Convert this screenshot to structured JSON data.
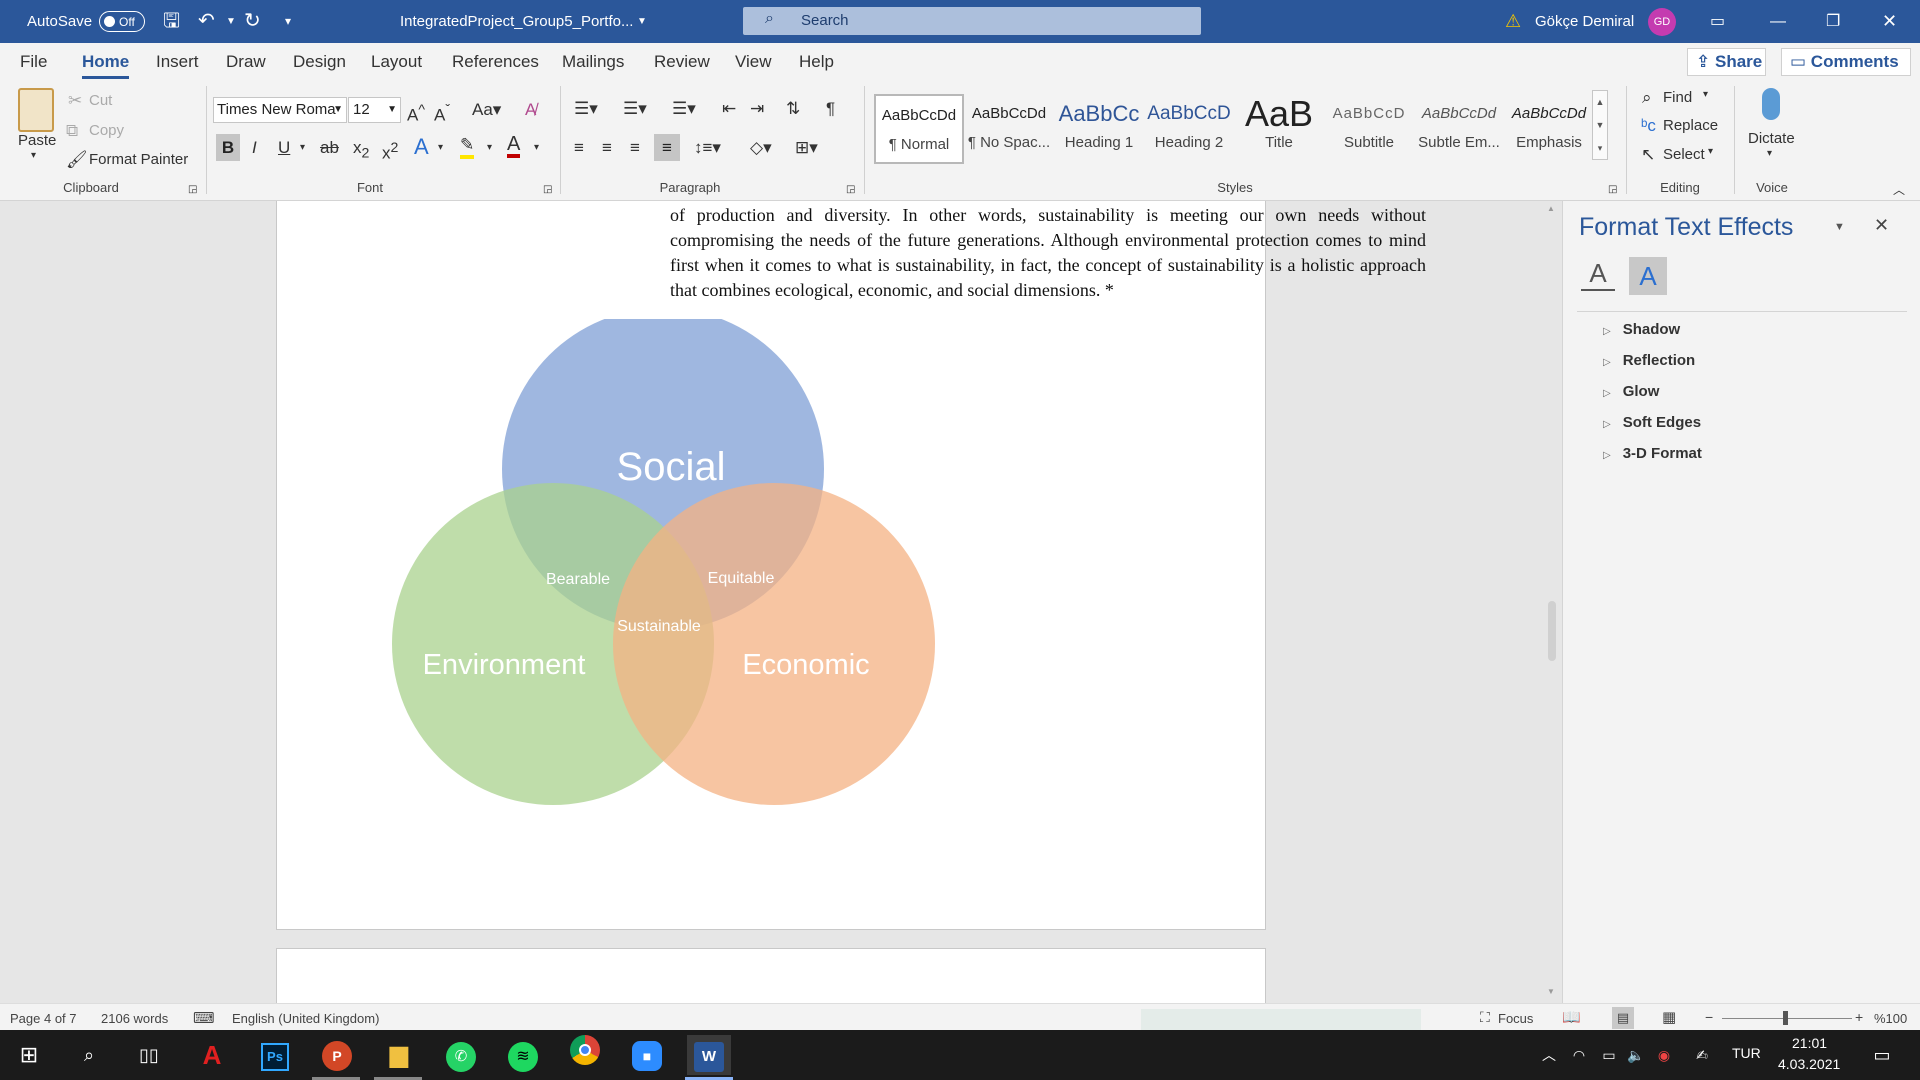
{
  "titlebar": {
    "autosave_label": "AutoSave",
    "autosave_state": "Off",
    "doc_title": "IntegratedProject_Group5_Portfo...",
    "search_placeholder": "Search",
    "user_name": "Gökçe Demiral",
    "user_initials": "GD"
  },
  "tabs": [
    "File",
    "Home",
    "Insert",
    "Draw",
    "Design",
    "Layout",
    "References",
    "Mailings",
    "Review",
    "View",
    "Help"
  ],
  "share_label": "Share",
  "comments_label": "Comments",
  "clipboard": {
    "paste": "Paste",
    "cut": "Cut",
    "copy": "Copy",
    "format_painter": "Format Painter",
    "group": "Clipboard"
  },
  "font": {
    "name": "Times New Roma",
    "size": "12",
    "group": "Font"
  },
  "paragraph": {
    "group": "Paragraph"
  },
  "styles": {
    "group": "Styles",
    "items": [
      {
        "preview": "AaBbCcDd",
        "name": "¶ Normal"
      },
      {
        "preview": "AaBbCcDd",
        "name": "¶ No Spac..."
      },
      {
        "preview": "AaBbCc",
        "name": "Heading 1"
      },
      {
        "preview": "AaBbCcD",
        "name": "Heading 2"
      },
      {
        "preview": "AaB",
        "name": "Title"
      },
      {
        "preview": "AaBbCcD",
        "name": "Subtitle"
      },
      {
        "preview": "AaBbCcDd",
        "name": "Subtle Em..."
      },
      {
        "preview": "AaBbCcDd",
        "name": "Emphasis"
      }
    ]
  },
  "editing": {
    "find": "Find",
    "replace": "Replace",
    "select": "Select",
    "group": "Editing"
  },
  "voice": {
    "dictate": "Dictate",
    "group": "Voice"
  },
  "document": {
    "paragraph": "The term of sustainability is creating a permanent life cycle for humanity while ensuring the continuity of production and diversity. In other words, sustainability is meeting our own needs without compromising the needs of the future generations. Although environmental protection comes to mind first when it comes to what is sustainability, in fact, the concept of sustainability is a holistic approach that combines ecological, economic, and social dimensions. *",
    "venn": {
      "social": "Social",
      "environment": "Environment",
      "economic": "Economic",
      "bearable": "Bearable",
      "equitable": "Equitable",
      "sustainable": "Sustainable",
      "colors": {
        "social": "#8eaadb",
        "environment": "#a9d18e",
        "economic": "#f4b183"
      }
    }
  },
  "pane": {
    "title": "Format Text Effects",
    "items": [
      "Shadow",
      "Reflection",
      "Glow",
      "Soft Edges",
      "3-D Format"
    ]
  },
  "status": {
    "page": "Page 4 of 7",
    "words": "2106 words",
    "language": "English (United Kingdom)",
    "focus": "Focus",
    "zoom": "%100"
  },
  "taskbar": {
    "lang": "TUR",
    "time": "21:01",
    "date": "4.03.2021"
  }
}
